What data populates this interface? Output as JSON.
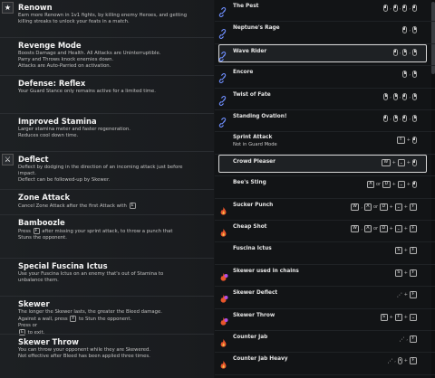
{
  "feats": [
    {
      "title": "Renown",
      "lines": [
        "Earn more Renown in 1v1 fights, by killing enemy Heroes, and getting",
        "killing streaks to unlock your feats in a match."
      ],
      "icon": "star-icon"
    },
    {
      "title": "Revenge Mode",
      "lines": [
        "Boosts Damage and Health. All Attacks are Uninterruptible.",
        "Parry and Throws knock enemies down.",
        "Attacks are Auto-Parried on activation."
      ]
    },
    {
      "title": "Defense: Reflex",
      "lines": [
        "Your Guard Stance only remains active for a limited time."
      ]
    },
    {
      "title": "Improved Stamina",
      "lines": [
        "Larger stamina meter and faster regeneration.",
        "Reduces cool down time."
      ]
    },
    {
      "title": "Deflect",
      "lines": [
        "Deflect by dodging in the direction of an incoming attack just before",
        "impact.",
        "Deflect can be followed-up by Skewer."
      ],
      "icon": "deflect-icon"
    },
    {
      "title": "Zone Attack",
      "lines": [
        "Cancel Zone Attack after the first Attack with"
      ],
      "key": "E"
    },
    {
      "title": "Bamboozle",
      "lines_k": [
        [
          "Press ",
          "F",
          " after missing your sprint attack, to throw a punch that"
        ],
        [
          "Stuns the opponent.",
          "",
          ""
        ]
      ]
    },
    {
      "title": "Special Fuscina Ictus",
      "lines": [
        "Use your Fuscina Ictus on an enemy that's out of Stamina to",
        "unbalance them."
      ]
    },
    {
      "title": "Skewer",
      "lines_k": [
        [
          "The longer the Skewer lasts, the greater the Bleed damage.",
          "",
          ""
        ],
        [
          "Against a wall, press ",
          "F",
          " to Stun the opponent."
        ],
        [
          "Press ",
          "",
          " or "
        ],
        [
          "",
          "E",
          " to exit."
        ]
      ]
    },
    {
      "title": "Skewer Throw",
      "lines": [
        "You can throw your opponent while they are Skewered.",
        "Not effective after Bleed has been applied three times."
      ]
    }
  ],
  "moves": [
    {
      "label": "The Pest",
      "icon": "chain-icon",
      "inputs": [
        "mouse-left",
        ",",
        "mouse-left",
        ",",
        "mouse-left",
        ",",
        "mouse-left"
      ]
    },
    {
      "label": "Neptune's Rage",
      "icon": "chain-icon",
      "inputs": [
        "mouse-left",
        ",",
        "mouse-right"
      ]
    },
    {
      "label": "Wave Rider",
      "icon": "chain-icon",
      "highlight": true,
      "inputs": [
        "mouse-left",
        ",",
        "mouse-right",
        ",",
        "mouse-right"
      ]
    },
    {
      "label": "Encore",
      "icon": "chain-icon",
      "inputs": [
        "mouse-right",
        ",",
        "mouse-right"
      ]
    },
    {
      "label": "Twist of Fate",
      "icon": "chain-icon",
      "inputs": [
        "mouse-right",
        ",",
        "mouse-right",
        ",",
        "mouse-left",
        ",",
        "mouse-right"
      ]
    },
    {
      "label": "Standing Ovation!",
      "icon": "chain-icon",
      "inputs": [
        "mouse-left",
        ",",
        "mouse-right",
        ",",
        "mouse-left",
        ",",
        "mouse-right"
      ]
    },
    {
      "label": "Sprint Attack",
      "sub": "Not in Guard Mode",
      "inputs": [
        "key:⇧",
        "+",
        "mouse-left"
      ]
    },
    {
      "label": "Crowd Pleaser",
      "highlight": true,
      "inputs": [
        "key:W",
        "+",
        "key:⎵",
        "+",
        "mouse-left"
      ]
    },
    {
      "label": "Bee's Sting",
      "inputs": [
        "key:A",
        "or",
        "key:D",
        "+",
        "key:⎵",
        "+",
        "mouse-left"
      ]
    },
    {
      "label": "Sucker Punch",
      "icon": "fire-icon",
      "inputs": [
        "key:W",
        ",",
        "key:A",
        "or",
        "key:D",
        "+",
        "key:⎵",
        "+",
        "key:F"
      ]
    },
    {
      "label": "Cheap Shot",
      "icon": "fire-icon",
      "inputs": [
        "key:W",
        ",",
        "key:A",
        "or",
        "key:D",
        "+",
        "key:⎵",
        "+",
        "key:F"
      ]
    },
    {
      "label": "Fuscina Ictus",
      "inputs": [
        "key:S",
        "+",
        "key:F"
      ]
    },
    {
      "label": "Skewer used in chains",
      "icon": "dot-purple-icon",
      "inputs": [
        "key:S",
        "+",
        "key:F"
      ]
    },
    {
      "label": "Skewer Deflect",
      "icon": "dot-purple-icon",
      "inputs": [
        "glyph:⋰",
        "+",
        "key:F"
      ]
    },
    {
      "label": "Skewer Throw",
      "icon": "dot-purple-icon",
      "inputs": [
        "key:S",
        "+",
        "key:F",
        "+",
        "key:⎵"
      ]
    },
    {
      "label": "Counter Jab",
      "icon": "fire-icon",
      "inputs": [
        "glyph:⋰",
        ",",
        "key:F"
      ]
    },
    {
      "label": "Counter Jab Heavy",
      "icon": "fire-icon",
      "inputs": [
        "glyph:⋰",
        ",",
        "mouse-mid",
        "+",
        "key:F"
      ]
    }
  ]
}
